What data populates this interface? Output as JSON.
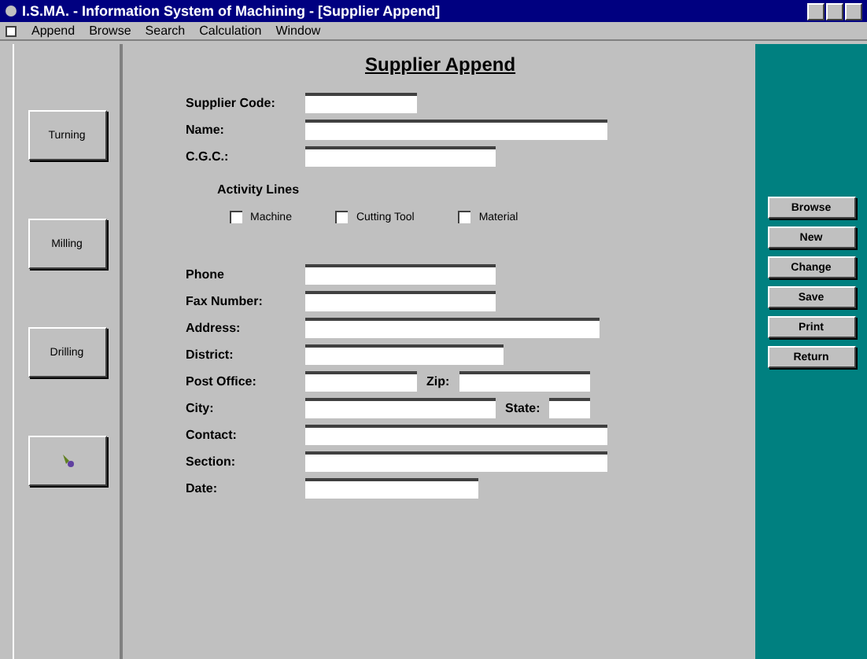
{
  "window": {
    "title": "I.S.MA. - Information System of Machining - [Supplier Append]"
  },
  "menu": [
    "Append",
    "Browse",
    "Search",
    "Calculation",
    "Window"
  ],
  "left_buttons": [
    {
      "kind": "text",
      "label": "Turning"
    },
    {
      "kind": "text",
      "label": "Milling"
    },
    {
      "kind": "text",
      "label": "Drilling"
    },
    {
      "kind": "icon"
    }
  ],
  "form": {
    "title": "Supplier Append",
    "top_fields": [
      {
        "label": "Supplier Code:"
      },
      {
        "label": "Name:"
      },
      {
        "label": "C.G.C.:"
      }
    ],
    "activity": {
      "label": "Activity Lines",
      "options": [
        {
          "label": "Machine",
          "checked": false
        },
        {
          "label": "Cutting Tool",
          "checked": false
        },
        {
          "label": "Material",
          "checked": false
        }
      ]
    },
    "fields": [
      {
        "kind": "single",
        "label": "Phone"
      },
      {
        "kind": "single",
        "label": "Fax Number:"
      },
      {
        "kind": "single",
        "label": "Address:"
      },
      {
        "kind": "single",
        "label": "District:"
      },
      {
        "kind": "pair",
        "label": "Post Office:",
        "label_2": "Zip:"
      },
      {
        "kind": "pair",
        "label": "City:",
        "label_2": "State:"
      },
      {
        "kind": "single",
        "label": "Contact:"
      },
      {
        "kind": "single",
        "label": "Section:"
      },
      {
        "kind": "single",
        "label": "Date:"
      }
    ]
  },
  "right_buttons": [
    "Browse",
    "New",
    "Change",
    "Save",
    "Print",
    "Return"
  ]
}
